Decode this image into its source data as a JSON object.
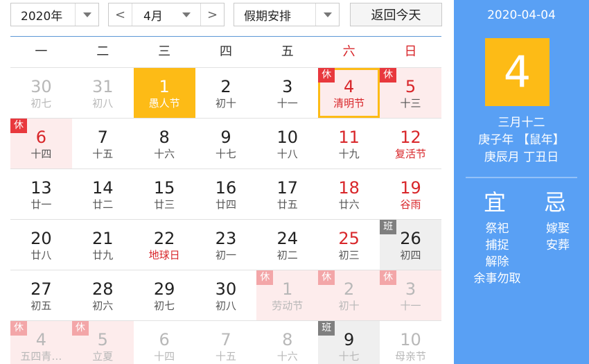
{
  "toolbar": {
    "year": "2020年",
    "month": "4月",
    "prev": "<",
    "next": ">",
    "holiday": "假期安排",
    "today_button": "返回今天"
  },
  "weekdays": [
    "一",
    "二",
    "三",
    "四",
    "五",
    "六",
    "日"
  ],
  "weeks": [
    [
      {
        "day": "30",
        "lunar": "初七",
        "other": true
      },
      {
        "day": "31",
        "lunar": "初八",
        "other": true
      },
      {
        "day": "1",
        "lunar": "愚人节",
        "selected": true
      },
      {
        "day": "2",
        "lunar": "初十"
      },
      {
        "day": "3",
        "lunar": "十一"
      },
      {
        "day": "4",
        "lunar": "清明节",
        "festival": true,
        "badge": "休",
        "rest": true,
        "outlined": true
      },
      {
        "day": "5",
        "lunar": "十三",
        "badge": "休",
        "rest": true
      }
    ],
    [
      {
        "day": "6",
        "lunar": "十四",
        "badge": "休",
        "rest": true,
        "weekendColor": true
      },
      {
        "day": "7",
        "lunar": "十五"
      },
      {
        "day": "8",
        "lunar": "十六"
      },
      {
        "day": "9",
        "lunar": "十七"
      },
      {
        "day": "10",
        "lunar": "十八"
      },
      {
        "day": "11",
        "lunar": "十九"
      },
      {
        "day": "12",
        "lunar": "复活节",
        "festival": true
      }
    ],
    [
      {
        "day": "13",
        "lunar": "廿一"
      },
      {
        "day": "14",
        "lunar": "廿二"
      },
      {
        "day": "15",
        "lunar": "廿三"
      },
      {
        "day": "16",
        "lunar": "廿四"
      },
      {
        "day": "17",
        "lunar": "廿五"
      },
      {
        "day": "18",
        "lunar": "廿六"
      },
      {
        "day": "19",
        "lunar": "谷雨",
        "festival": true
      }
    ],
    [
      {
        "day": "20",
        "lunar": "廿八"
      },
      {
        "day": "21",
        "lunar": "廿九"
      },
      {
        "day": "22",
        "lunar": "地球日",
        "festival": true
      },
      {
        "day": "23",
        "lunar": "初一"
      },
      {
        "day": "24",
        "lunar": "初二"
      },
      {
        "day": "25",
        "lunar": "初三"
      },
      {
        "day": "26",
        "lunar": "初四",
        "badge": "班",
        "workday": true,
        "plainNum": true
      }
    ],
    [
      {
        "day": "27",
        "lunar": "初五"
      },
      {
        "day": "28",
        "lunar": "初六"
      },
      {
        "day": "29",
        "lunar": "初七"
      },
      {
        "day": "30",
        "lunar": "初八"
      },
      {
        "day": "1",
        "lunar": "劳动节",
        "other": true,
        "badge": "休",
        "rest": true
      },
      {
        "day": "2",
        "lunar": "初十",
        "other": true,
        "badge": "休",
        "rest": true
      },
      {
        "day": "3",
        "lunar": "十一",
        "other": true,
        "badge": "休",
        "rest": true
      }
    ],
    [
      {
        "day": "4",
        "lunar": "五四青…",
        "other": true,
        "badge": "休",
        "rest": true
      },
      {
        "day": "5",
        "lunar": "立夏",
        "other": true,
        "badge": "休",
        "rest": true
      },
      {
        "day": "6",
        "lunar": "十四",
        "other": true
      },
      {
        "day": "7",
        "lunar": "十五",
        "other": true
      },
      {
        "day": "8",
        "lunar": "十六",
        "other": true
      },
      {
        "day": "9",
        "lunar": "十七",
        "badge": "班",
        "workday": true,
        "plainNum": true,
        "dimLunar": true
      },
      {
        "day": "10",
        "lunar": "母亲节",
        "other": true
      }
    ]
  ],
  "panel": {
    "date": "2020-04-04",
    "day": "4",
    "lunar_date": "三月十二",
    "year_ganzhi": "庚子年 【鼠年】",
    "month_day_ganzhi": "庚辰月 丁丑日",
    "yi_title": "宜",
    "ji_title": "忌",
    "yi": [
      "祭祀",
      "捕捉",
      "解除",
      "余事勿取"
    ],
    "ji": [
      "嫁娶",
      "安葬"
    ]
  },
  "colors": {
    "accent": "#59a0f4",
    "selected": "#fdbb16",
    "holiday_red": "#d8262a",
    "rest_bg": "#fdecec",
    "workday_bg": "#efefef"
  }
}
